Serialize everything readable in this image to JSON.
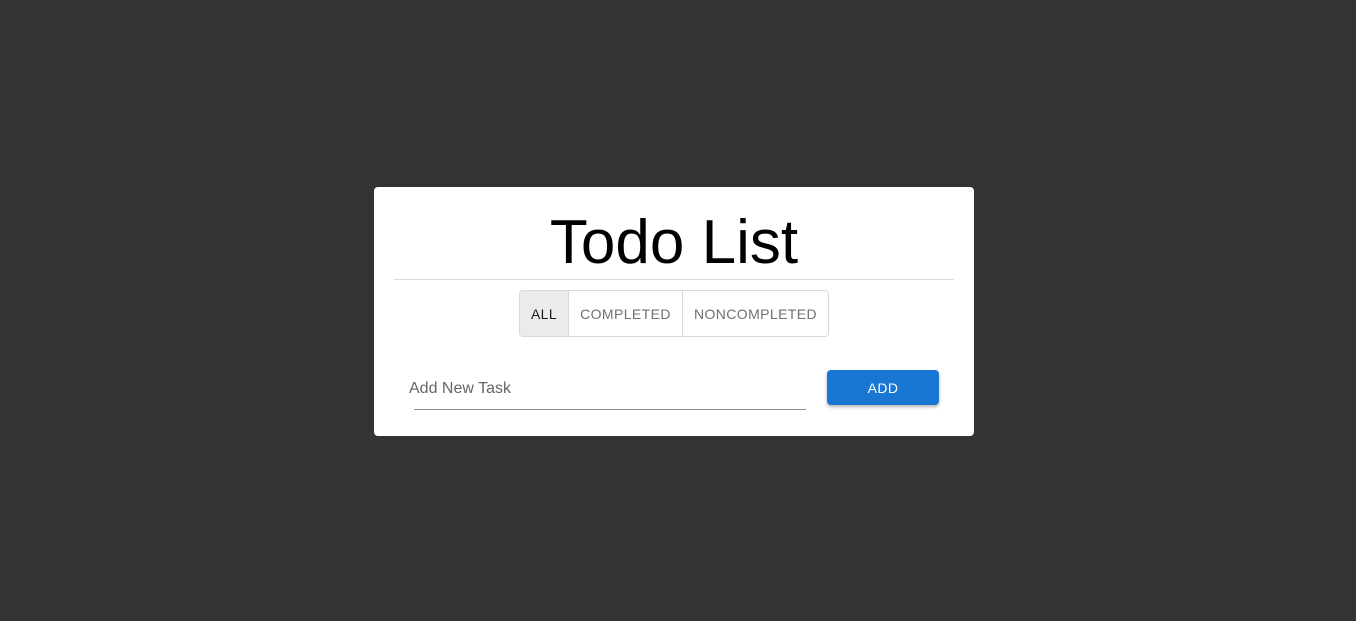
{
  "app": {
    "title": "Todo List"
  },
  "filters": {
    "items": [
      {
        "label": "ALL",
        "active": true
      },
      {
        "label": "COMPLETED",
        "active": false
      },
      {
        "label": "NONCOMPLETED",
        "active": false
      }
    ]
  },
  "task_input": {
    "placeholder": "Add New Task",
    "value": ""
  },
  "add_button": {
    "label": "ADD"
  },
  "colors": {
    "background": "#333333",
    "card": "#ffffff",
    "accent": "#1976d2",
    "active_filter": "#ebebeb"
  }
}
